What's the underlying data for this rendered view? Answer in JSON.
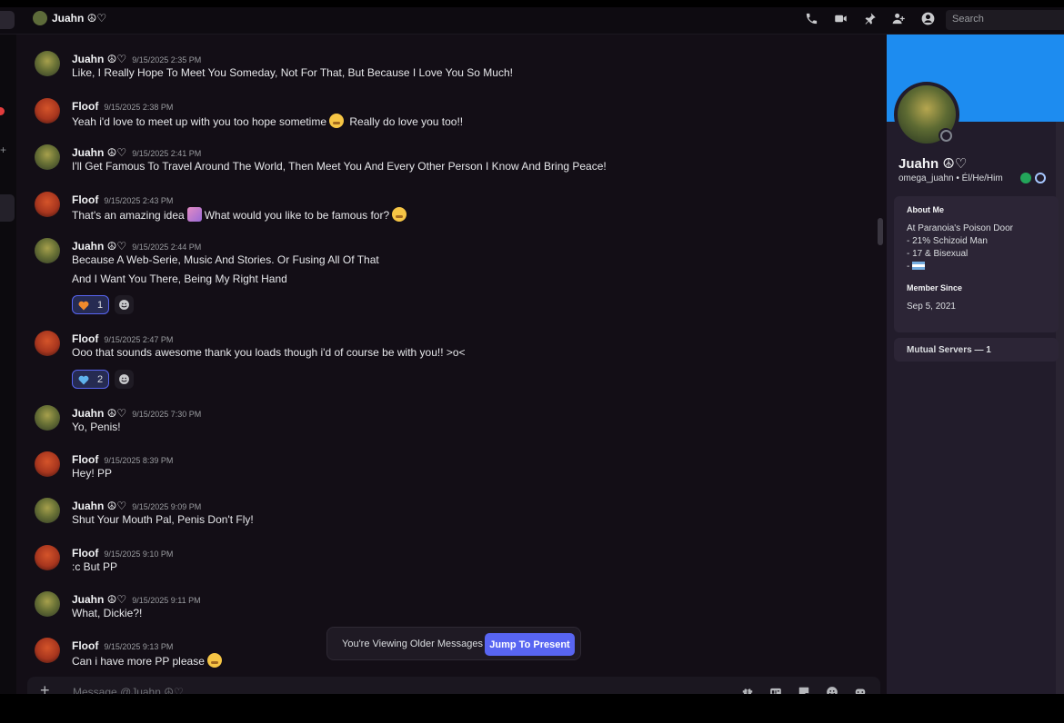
{
  "header": {
    "title": "Juahn ☮♡",
    "icons": [
      "phone-call-icon",
      "video-call-icon",
      "pin-icon",
      "add-friends-icon",
      "user-profile-icon"
    ],
    "search_placeholder": "Search"
  },
  "messages": [
    {
      "author": "Juahn ☮♡",
      "time": "9/15/2025 2:35 PM",
      "lines": [
        "Like, I Really Hope To Meet You Someday, Not For That, But Because I Love You So Much!"
      ]
    },
    {
      "author": "Floof",
      "time": "9/15/2025 2:38 PM",
      "lines": [
        "Yeah i'd love to meet up with you too hope sometime",
        "Really do love you too!!"
      ]
    },
    {
      "author": "Juahn ☮♡",
      "time": "9/15/2025 2:41 PM",
      "lines": [
        "I'll Get Famous To Travel Around The World, Then Meet You And Every Other Person I Know And Bring Peace!"
      ]
    },
    {
      "author": "Floof",
      "time": "9/15/2025 2:43 PM",
      "lines": [
        "That's an amazing idea",
        "What would you like to be famous for?"
      ]
    },
    {
      "author": "Juahn ☮♡",
      "time": "9/15/2025 2:44 PM",
      "lines": [
        "Because A Web-Serie, Music And Stories. Or Fusing All Of That",
        "And I Want You There, Being My Right Hand"
      ],
      "reaction": {
        "emoji": "orange-heart",
        "count": "1"
      }
    },
    {
      "author": "Floof",
      "time": "9/15/2025 2:47 PM",
      "lines": [
        "Ooo that sounds awesome thank you loads though i'd of course be with you!! >o<"
      ],
      "reaction": {
        "emoji": "blue-heart",
        "count": "2"
      }
    },
    {
      "author": "Juahn ☮♡",
      "time": "9/15/2025 7:30 PM",
      "lines": [
        "Yo, Penis!"
      ]
    },
    {
      "author": "Floof",
      "time": "9/15/2025 8:39 PM",
      "lines": [
        "Hey! PP"
      ]
    },
    {
      "author": "Juahn ☮♡",
      "time": "9/15/2025 9:09 PM",
      "lines": [
        "Shut Your Mouth Pal, Penis Don't Fly!"
      ]
    },
    {
      "author": "Floof",
      "time": "9/15/2025 9:10 PM",
      "lines": [
        ":c But PP"
      ]
    },
    {
      "author": "Juahn ☮♡",
      "time": "9/15/2025 9:11 PM",
      "lines": [
        "What, Dickie?!"
      ]
    },
    {
      "author": "Floof",
      "time": "9/15/2025 9:13 PM",
      "lines": [
        "Can i have more PP please"
      ]
    }
  ],
  "older_banner": {
    "text": "You're Viewing Older Messages",
    "button": "Jump To Present"
  },
  "composer": {
    "placeholder": "Message @Juahn ☮♡",
    "icons": [
      "gift-icon",
      "gif-icon",
      "sticker-icon",
      "emoji-icon",
      "apps-icon"
    ]
  },
  "profile": {
    "banner_color": "#1d8cf0",
    "display_name": "Juahn ☮♡",
    "username": "omega_juahn",
    "pronouns": "Él/He/Him",
    "about_title": "About Me",
    "about_lines": [
      "At Paranoia's Poison Door",
      "- 21% Schizoid Man",
      "- 17 & Bisexual",
      "-"
    ],
    "member_since_title": "Member Since",
    "member_since": "Sep 5, 2021",
    "mutual_servers": "Mutual Servers — 1"
  },
  "colors": {
    "accent": "#5865f2",
    "orange_heart": "#f08a2c",
    "blue_heart": "#5fb2ec"
  }
}
